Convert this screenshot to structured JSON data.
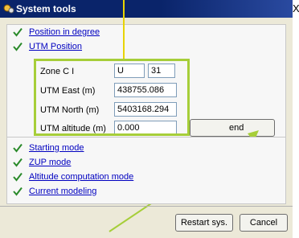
{
  "window": {
    "title": "System tools",
    "close_glyph": "X"
  },
  "top_items": [
    {
      "label": "Position in degree",
      "icon": "check-icon"
    },
    {
      "label": "UTM Position",
      "icon": "check-icon"
    }
  ],
  "utm": {
    "zone_label": "Zone C I",
    "zone_letter": "U",
    "zone_number": "31",
    "east_label": "UTM East (m)",
    "east_value": "438755.086",
    "north_label": "UTM North (m)",
    "north_value": "5403168.294",
    "altitude_label": "UTM altitude (m)",
    "altitude_value": "0.000",
    "send_label": "end"
  },
  "bottom_items": [
    {
      "label": "Starting mode",
      "icon": "check-icon"
    },
    {
      "label": "ZUP mode",
      "icon": "check-icon"
    },
    {
      "label": "Altitude computation mode",
      "icon": "check-icon"
    },
    {
      "label": "Current modeling",
      "icon": "check-icon"
    }
  ],
  "footer": {
    "restart_label": "Restart sys.",
    "cancel_label": "Cancel"
  },
  "colors": {
    "title_bar": "#0a246a",
    "highlight": "#a6ce39",
    "check": "#2a8a2a",
    "link": "#0000c0"
  }
}
